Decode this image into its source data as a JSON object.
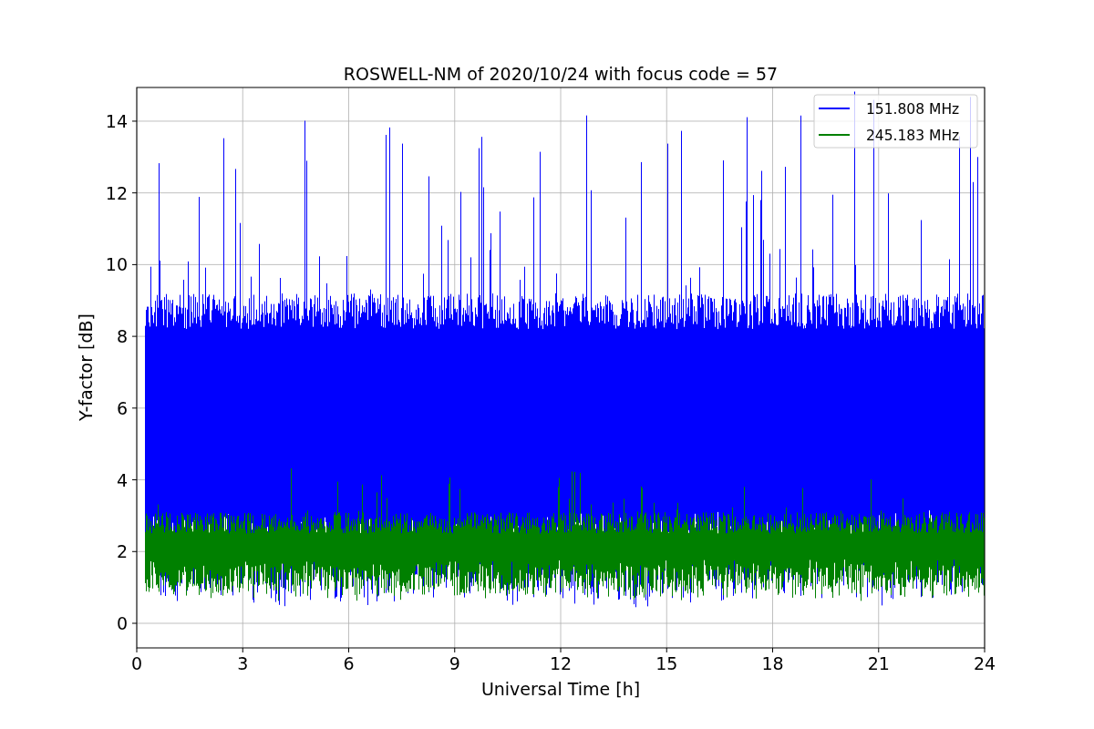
{
  "figure": {
    "title": "ROSWELL-NM of 2020/10/24 with focus code = 57",
    "xlabel": "Universal Time [h]",
    "ylabel": "Y-factor [dB]",
    "xticks": [
      "0",
      "3",
      "6",
      "9",
      "12",
      "15",
      "18",
      "21",
      "24"
    ],
    "yticks": [
      "14",
      "12",
      "10",
      "8",
      "6",
      "4",
      "2",
      "0"
    ],
    "legend": [
      {
        "label": "151.808 MHz",
        "color": "#0000ff"
      },
      {
        "label": "245.183 MHz",
        "color": "#008000"
      }
    ]
  }
}
